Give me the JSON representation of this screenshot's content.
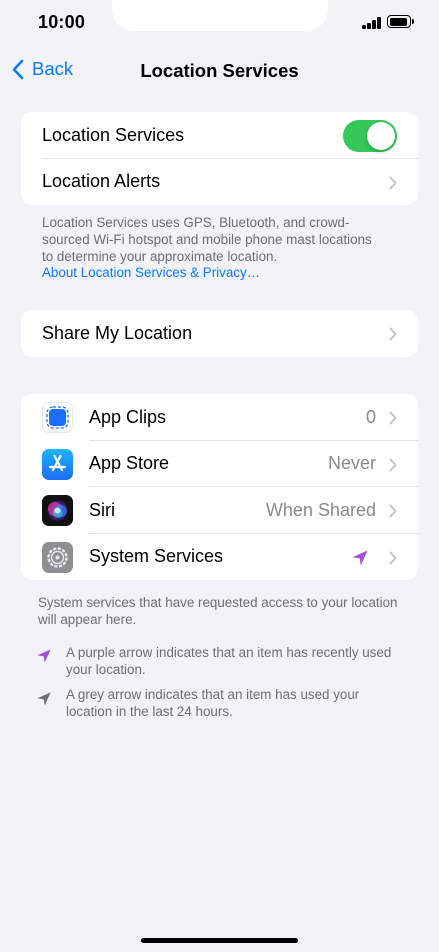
{
  "status_bar": {
    "time": "10:00"
  },
  "nav": {
    "back_label": "Back",
    "title": "Location Services"
  },
  "section1": {
    "location_services_label": "Location Services",
    "location_services_on": true,
    "location_alerts_label": "Location Alerts",
    "footnote": "Location Services uses GPS, Bluetooth, and crowd-sourced Wi-Fi hotspot and mobile phone mast locations to determine your approximate location.",
    "footnote_link": "About Location Services & Privacy…"
  },
  "section2": {
    "share_label": "Share My Location"
  },
  "apps": [
    {
      "label": "App Clips",
      "value": "0",
      "icon": "app-clips-icon"
    },
    {
      "label": "App Store",
      "value": "Never",
      "icon": "app-store-icon"
    },
    {
      "label": "Siri",
      "value": "When Shared",
      "icon": "siri-icon"
    },
    {
      "label": "System Services",
      "value": "",
      "icon": "system-services-icon",
      "indicator": "purple-arrow"
    }
  ],
  "apps_footnote": "System services that have requested access to your location will appear here.",
  "legend": {
    "purple": "A purple arrow indicates that an item has recently used your location.",
    "grey": "A grey arrow indicates that an item has used your location in the last 24 hours."
  },
  "colors": {
    "accent": "#0a7aff",
    "toggle_on": "#34c759",
    "purple_arrow": "#a550d9",
    "grey_arrow": "#707074"
  }
}
